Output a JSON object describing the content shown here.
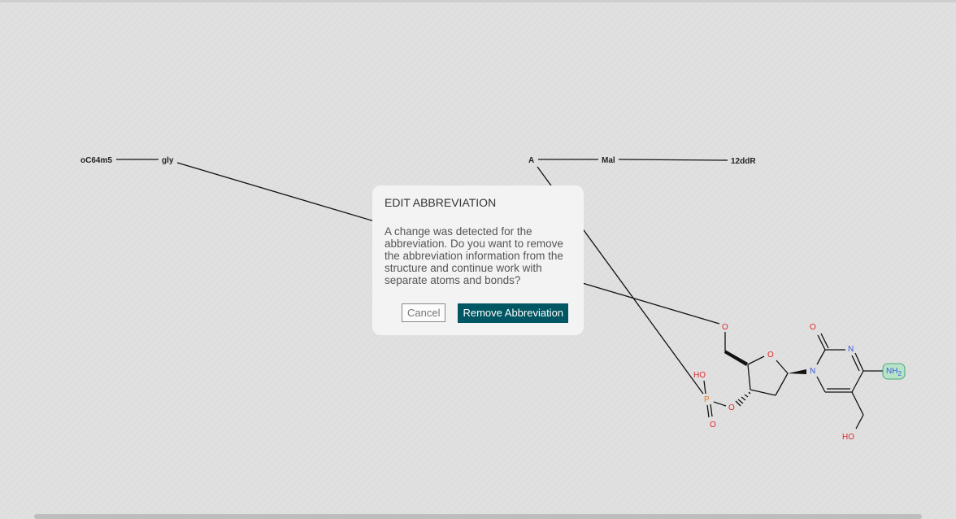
{
  "canvas": {
    "abbreviations": [
      "oC64m5",
      "gly",
      "A",
      "Mal",
      "12ddR"
    ],
    "atoms": {
      "o1": "O",
      "o_ring": "O",
      "o_carbonyl": "O",
      "n_ring1": "N",
      "n_ring2": "N",
      "nh2": "NH",
      "nh2_sub": "2",
      "ho_phos": "HO",
      "p": "P",
      "o_ester": "O",
      "o_double": "O",
      "ho_bottom": "HO"
    }
  },
  "dialog": {
    "title": "EDIT ABBREVIATION",
    "message": "A change was detected for the abbreviation. Do you want to remove the abbreviation information from the structure and continue work with separate atoms and bonds?",
    "cancel_label": "Cancel",
    "confirm_label": "Remove Abbreviation"
  },
  "colors": {
    "oxygen": "#e0282c",
    "nitrogen": "#3a5bd9",
    "phosphorus": "#e07b1a",
    "highlight": "#b8e3c9",
    "primary_button": "#005662"
  }
}
